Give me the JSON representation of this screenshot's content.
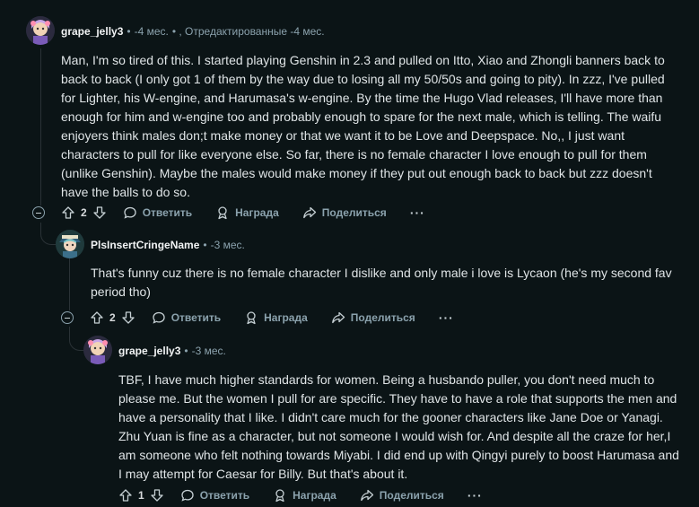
{
  "comments": [
    {
      "author": "grape_jelly3",
      "sep": "•",
      "time": "-4 мес.",
      "edited": " • , Отредактированные -4 мес.",
      "body": "Man, I'm so tired of this. I started playing Genshin in 2.3 and pulled on Itto, Xiao and Zhongli banners back to back to back (I only got 1 of them by the way due to losing all my 50/50s and going to pity). In zzz, I've pulled for Lighter, his W-engine, and Harumasa's w-engine. By the time the Hugo Vlad releases, I'll have more than enough for him and w-engine too and probably enough to spare for the next male, which is telling. The waifu enjoyers think males don;t make money or that we want it to be Love and Deepspace. No,, I just want characters to pull for like everyone else. So far, there is no female character I love enough to pull for them (unlike Genshin). Maybe the males would make money if they put out enough back to back but zzz doesn't have the balls to do so.",
      "votes": "2"
    },
    {
      "author": "PlsInsertCringeName",
      "sep": "•",
      "time": "-3 мес.",
      "body": "That's funny cuz there is no female character I dislike and only male i love is Lycaon (he's my second fav period tho)",
      "votes": "2"
    },
    {
      "author": "grape_jelly3",
      "sep": "•",
      "time": "-3 мес.",
      "body": "TBF, I have much higher standards for women. Being a husbando puller, you don't need much to please me. But the women I pull for are specific. They have to have a role that supports the men and have a personality that I like. I didn't care much for the gooner characters like Jane Doe or Yanagi. Zhu Yuan is fine as a character, but not someone I would wish for. And despite all the craze for her,I am someone who felt nothing towards Miyabi. I did end up with Qingyi purely to boost Harumasa and I may attempt for Caesar for Billy. But that's about it.",
      "votes": "1"
    }
  ],
  "actions": {
    "reply": "Ответить",
    "award": "Награда",
    "share": "Поделиться",
    "more": "···"
  },
  "icons": {
    "upvote": "arrow-up-icon",
    "downvote": "arrow-down-icon",
    "reply": "speech-bubble-icon",
    "award": "award-icon",
    "share": "share-arrow-icon",
    "collapse": "collapse-minus-icon"
  },
  "colors": {
    "background": "#0b1416",
    "text": "#dfe4e6",
    "muted": "#8ba2ad"
  }
}
